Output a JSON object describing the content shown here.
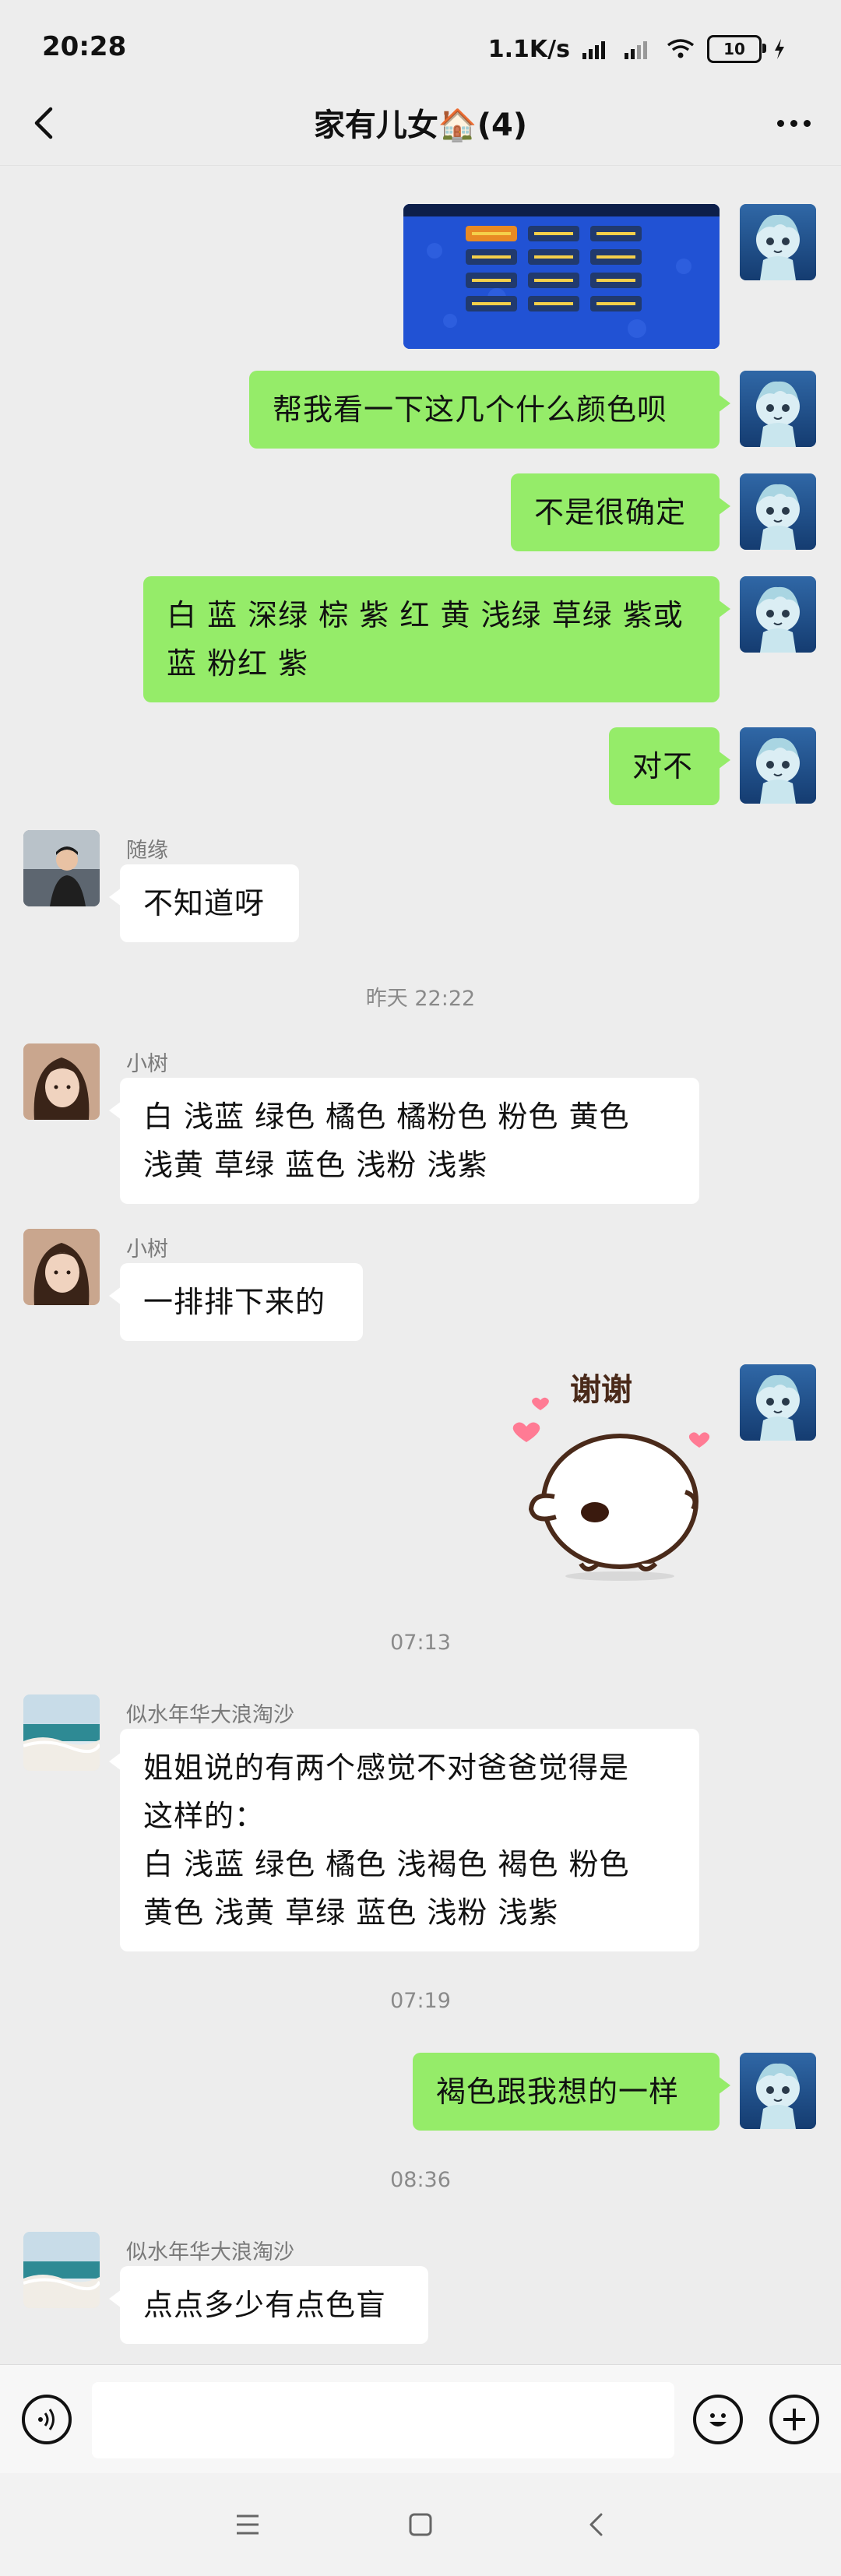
{
  "status_bar": {
    "time": "20:28",
    "network_speed": "1.1K/s",
    "battery": "10"
  },
  "header": {
    "title": "家有儿女🏠(4)"
  },
  "messages": [
    {
      "id": "m1",
      "side": "right",
      "type": "image"
    },
    {
      "id": "m2",
      "side": "right",
      "lines": [
        "帮我看一下这几个什么颜色呗"
      ]
    },
    {
      "id": "m3",
      "side": "right",
      "lines": [
        "不是很确定"
      ]
    },
    {
      "id": "m4",
      "side": "right",
      "lines": [
        "白 蓝 深绿 棕 紫 红 黄 浅绿 草绿 紫或",
        "蓝 粉红 紫"
      ]
    },
    {
      "id": "m5",
      "side": "right",
      "lines": [
        "对不"
      ]
    },
    {
      "id": "m6",
      "side": "left",
      "sender": "随缘",
      "lines": [
        "不知道呀"
      ]
    },
    {
      "id": "t1",
      "type": "time",
      "text": "昨天 22:22"
    },
    {
      "id": "m7",
      "side": "left",
      "sender": "小树",
      "lines": [
        "白 浅蓝 绿色 橘色 橘粉色 粉色 黄色",
        "浅黄 草绿 蓝色 浅粉 浅紫"
      ]
    },
    {
      "id": "m8",
      "side": "left",
      "sender": "小树",
      "lines": [
        "一排排下来的"
      ]
    },
    {
      "id": "m9",
      "side": "right",
      "type": "sticker",
      "sticker_text": "谢谢"
    },
    {
      "id": "t2",
      "type": "time",
      "text": "07:13"
    },
    {
      "id": "m10",
      "side": "left",
      "sender": "似水年华大浪淘沙",
      "lines": [
        "姐姐说的有两个感觉不对爸爸觉得是",
        "这样的：",
        "白 浅蓝 绿色 橘色 浅褐色 褐色 粉色",
        "黄色 浅黄 草绿 蓝色 浅粉 浅紫"
      ]
    },
    {
      "id": "t3",
      "type": "time",
      "text": "07:19"
    },
    {
      "id": "m11",
      "side": "right",
      "lines": [
        "褐色跟我想的一样"
      ]
    },
    {
      "id": "t4",
      "type": "time",
      "text": "08:36"
    },
    {
      "id": "m12",
      "side": "left",
      "sender": "似水年华大浪淘沙",
      "lines": [
        "点点多少有点色盲"
      ]
    }
  ],
  "input_bar": {
    "placeholder": ""
  },
  "colors": {
    "my_bubble": "#95ec69",
    "other_bubble": "#ffffff",
    "background": "#ededed"
  }
}
